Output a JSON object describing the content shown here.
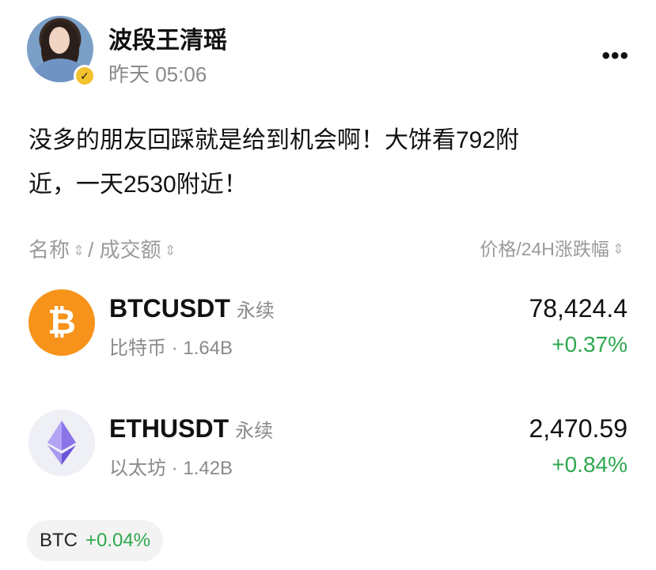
{
  "post": {
    "author": "波段王清瑶",
    "time": "昨天 05:06",
    "more": "•••",
    "text_line1": "没多的朋友回踩就是给到机会啊！大饼看792附",
    "text_line2": "近，一天2530附近！"
  },
  "table_header": {
    "left": "名称",
    "left_sep": "/",
    "left2": "成交额",
    "right": "价格/24H涨跌幅"
  },
  "tickers": [
    {
      "symbol": "BTCUSDT",
      "type": "永续",
      "name": "比特币",
      "sep": "·",
      "volume": "1.64B",
      "price": "78,424.4",
      "change": "+0.37%",
      "icon": "bitcoin-icon"
    },
    {
      "symbol": "ETHUSDT",
      "type": "永续",
      "name": "以太坊",
      "sep": "·",
      "volume": "1.42B",
      "price": "2,470.59",
      "change": "+0.84%",
      "icon": "ethereum-icon"
    }
  ],
  "chip": {
    "symbol": "BTC",
    "change": "+0.04%"
  },
  "colors": {
    "positive": "#2fa84f",
    "btc": "#f7931a",
    "badge": "#f2c12e"
  }
}
